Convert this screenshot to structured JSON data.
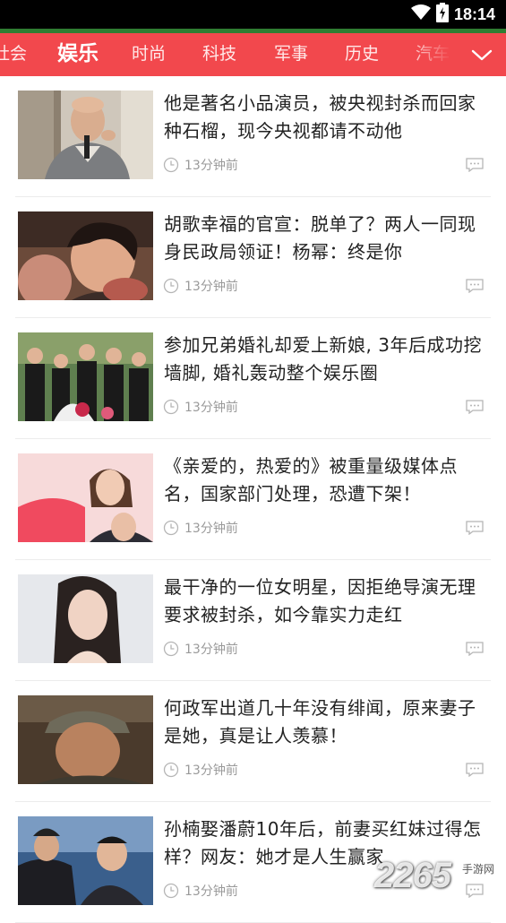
{
  "status_bar": {
    "time": "18:14",
    "icons": [
      "wifi-icon",
      "battery-icon"
    ]
  },
  "nav": {
    "tabs": [
      {
        "label": "社会",
        "active": false
      },
      {
        "label": "娱乐",
        "active": true
      },
      {
        "label": "时尚",
        "active": false
      },
      {
        "label": "科技",
        "active": false
      },
      {
        "label": "军事",
        "active": false
      },
      {
        "label": "历史",
        "active": false
      },
      {
        "label": "汽车",
        "active": false
      }
    ],
    "more_icon": "chevron-down-icon",
    "accent_color": "#f2484d"
  },
  "articles": [
    {
      "title": "他是著名小品演员，被央视封杀而回家种石榴，现今央视都请不动他",
      "time": "13分钟前"
    },
    {
      "title": "胡歌幸福的官宣：脱单了？两人一同现身民政局领证！杨幂：终是你",
      "time": "13分钟前"
    },
    {
      "title": "参加兄弟婚礼却爱上新娘, 3年后成功挖墙脚, 婚礼轰动整个娱乐圈",
      "time": "13分钟前"
    },
    {
      "title": "《亲爱的，热爱的》被重量级媒体点名，国家部门处理，恐遭下架！",
      "time": "13分钟前"
    },
    {
      "title": "最干净的一位女明星，因拒绝导演无理要求被封杀，如今靠实力走红",
      "time": "13分钟前"
    },
    {
      "title": "何政军出道几十年没有绯闻，原来妻子是她，真是让人羡慕！",
      "time": "13分钟前"
    },
    {
      "title": "孙楠娶潘蔚10年后，前妻买红妹过得怎样？网友：她才是人生赢家",
      "time": "13分钟前"
    }
  ],
  "watermark": {
    "text": "2265",
    "sub": "手游网"
  }
}
